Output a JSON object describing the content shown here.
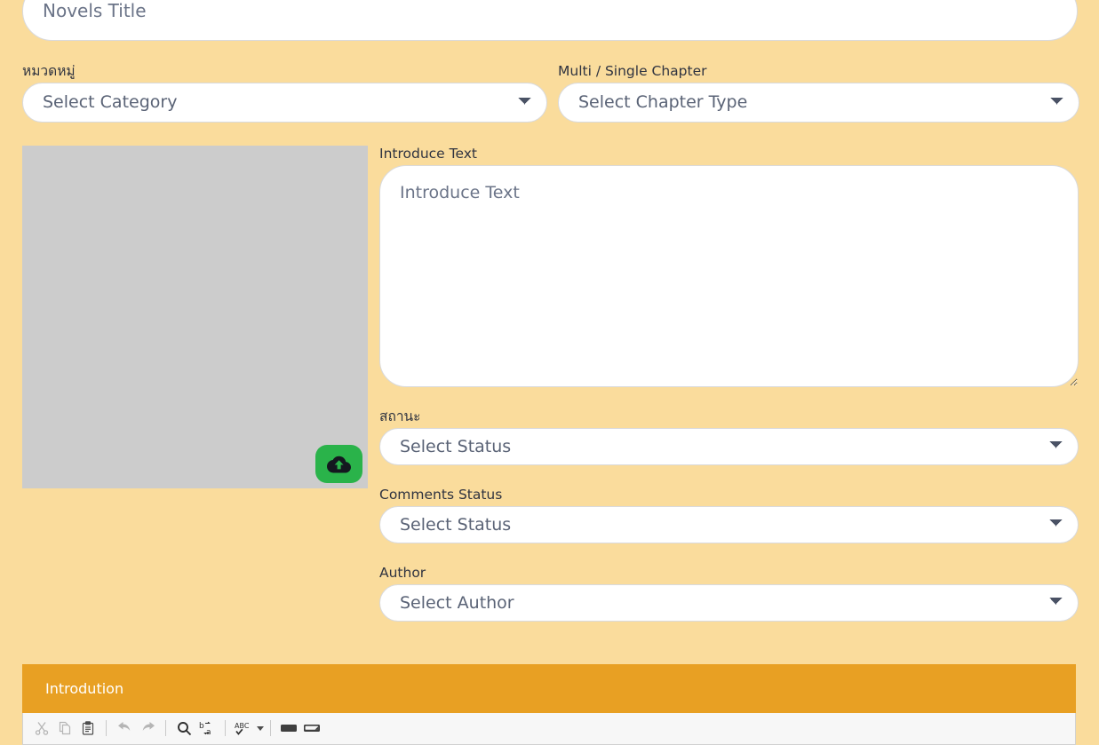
{
  "theme": {
    "page_background": "#fadc9c",
    "field_background": "#ffffff",
    "field_border": "#d9dadd",
    "field_text": "#5a6376",
    "label_text": "#2f3340",
    "cover_placeholder": "#cccccc",
    "upload_button": "#2ab34a",
    "editor_header": "#e8a023",
    "editor_toolbar_background": "#f7f7f7"
  },
  "form": {
    "title_field": {
      "placeholder": "Novels Title",
      "value": ""
    },
    "category": {
      "label": "หมวดหมู่",
      "selected": "Select Category"
    },
    "chapter_type": {
      "label": "Multi / Single Chapter",
      "selected": "Select Chapter Type"
    },
    "cover": {
      "upload_icon": "cloud-upload-icon"
    },
    "introduce_text": {
      "label": "Introduce Text",
      "placeholder": "Introduce Text",
      "value": ""
    },
    "status": {
      "label": "สถานะ",
      "selected": "Select Status"
    },
    "comments_status": {
      "label": "Comments Status",
      "selected": "Select Status"
    },
    "author": {
      "label": "Author",
      "selected": "Select Author"
    }
  },
  "editor": {
    "header_title": "Introdution",
    "toolbar": [
      {
        "name": "cut-icon",
        "label": "Cut",
        "dim": true
      },
      {
        "name": "copy-icon",
        "label": "Copy",
        "dim": true
      },
      {
        "name": "paste-icon",
        "label": "Paste",
        "dim": false
      },
      {
        "name": "undo-icon",
        "label": "Undo",
        "dim": true
      },
      {
        "name": "redo-icon",
        "label": "Redo",
        "dim": true
      },
      {
        "name": "find-icon",
        "label": "Find",
        "dim": false
      },
      {
        "name": "replace-icon",
        "label": "Replace",
        "dim": false
      },
      {
        "name": "spellcheck-icon",
        "label": "Spell Check As You Type",
        "dim": false
      },
      {
        "name": "text-field-icon",
        "label": "Text Field",
        "dim": false
      },
      {
        "name": "textarea-icon",
        "label": "Textarea",
        "dim": false
      }
    ]
  }
}
